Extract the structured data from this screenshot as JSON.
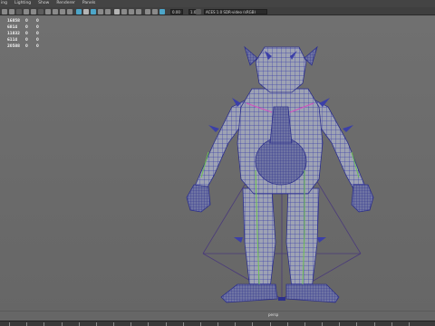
{
  "menu": [
    "ing",
    "Lighting",
    "Show",
    "Renderer",
    "Panels"
  ],
  "toolbar": {
    "num_field_1": "0.00",
    "num_field_2": "1.00",
    "space_field": "ACES 1.0 SDR-video (sRGB)"
  },
  "hud": {
    "rows": [
      [
        "16858",
        "0",
        "0"
      ],
      [
        "6814",
        "0",
        "0"
      ],
      [
        "11832",
        "0",
        "0"
      ],
      [
        "6114",
        "0",
        "0"
      ],
      [
        "20588",
        "0",
        "0"
      ]
    ]
  },
  "viewport": {
    "camera_label": "persp",
    "background": "#6c6c6c",
    "mesh_color": "#3b3fa8",
    "joint_color": "#c0a24d",
    "highlight_green": "#6fc34f",
    "highlight_magenta": "#d44fc0"
  },
  "timeline": {
    "ticks": 24
  }
}
